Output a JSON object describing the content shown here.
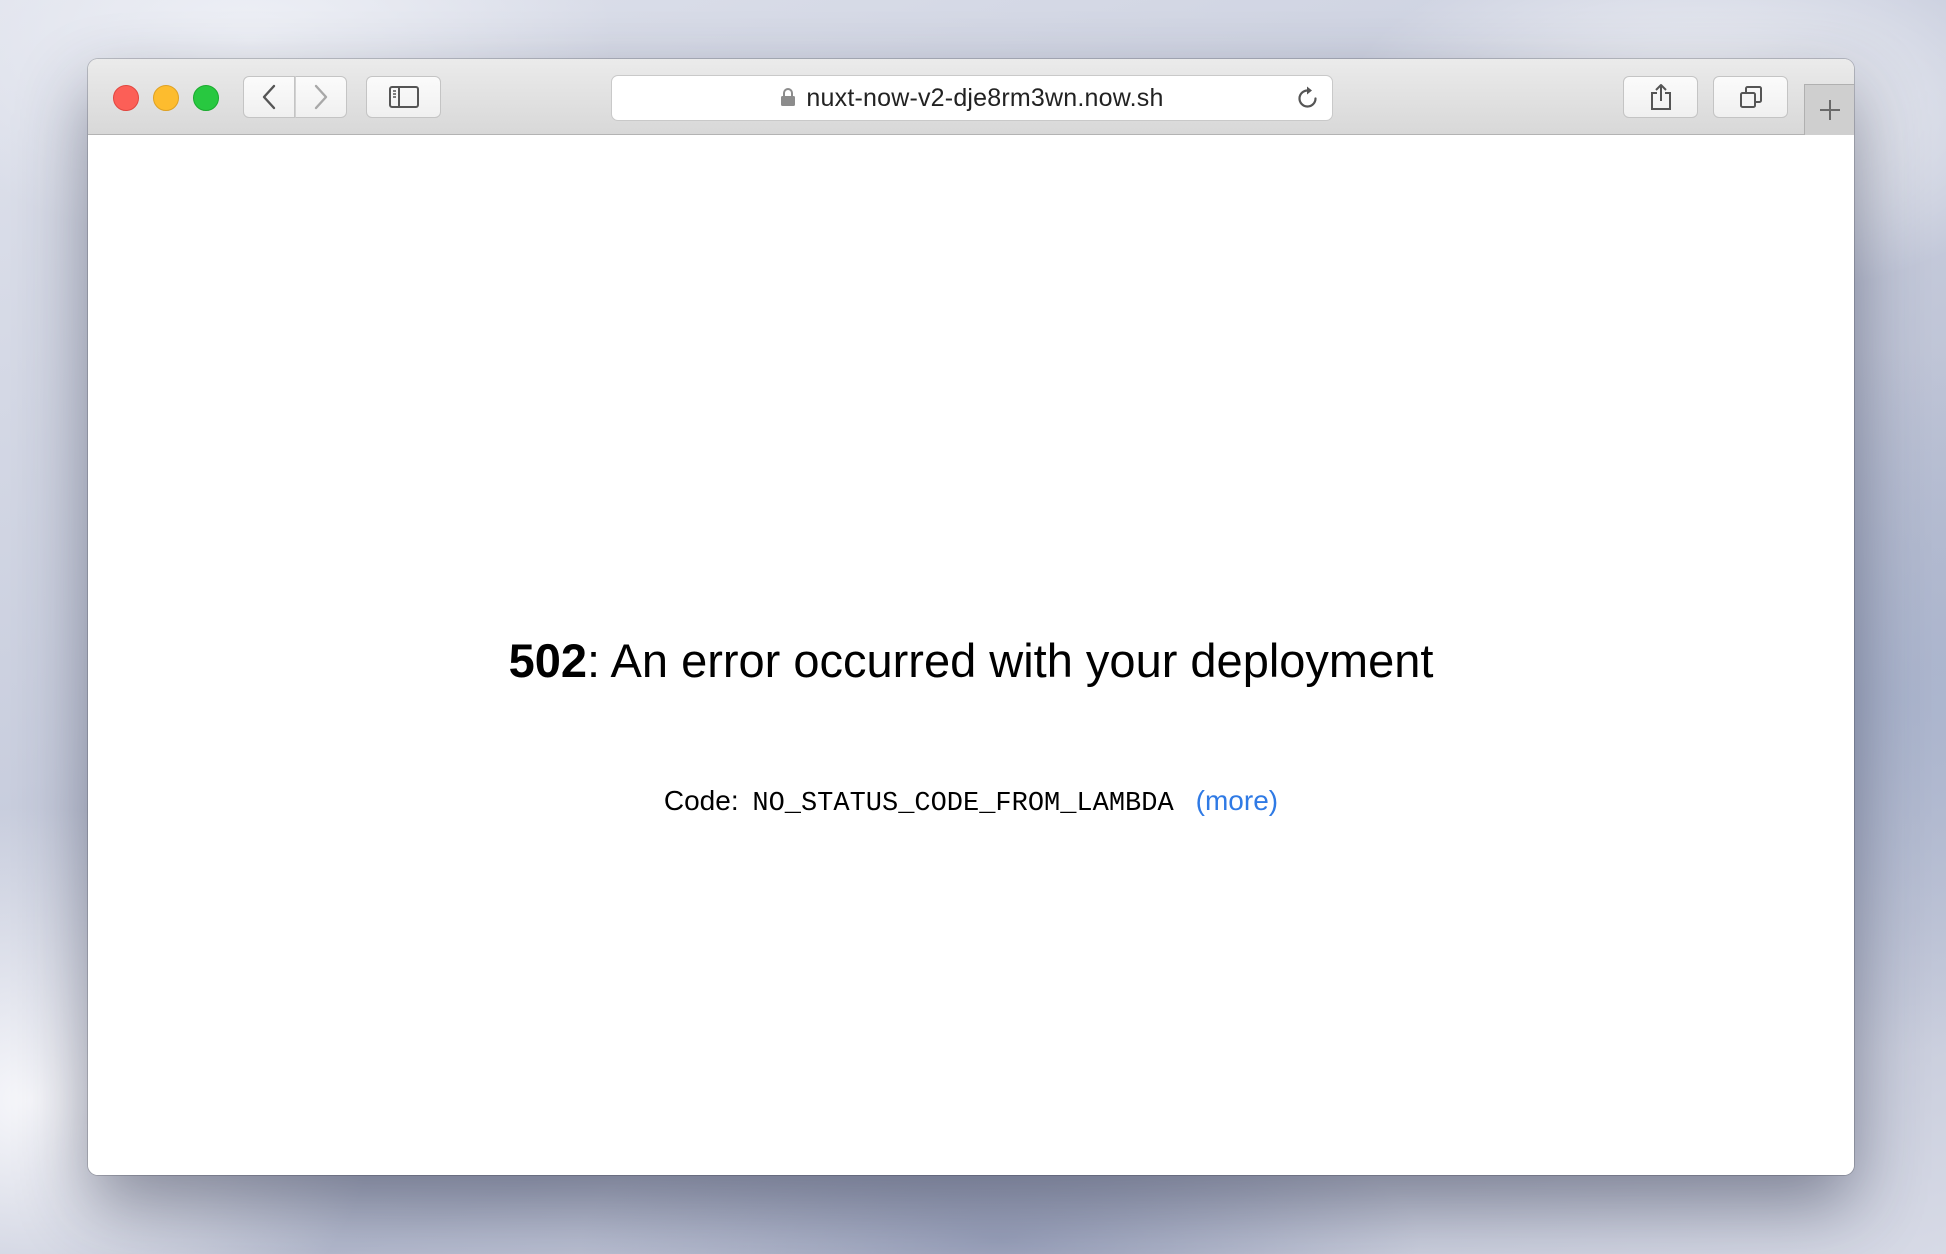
{
  "browser": {
    "address_bar": {
      "url": "nuxt-now-v2-dje8rm3wn.now.sh",
      "secure_icon": "lock-icon",
      "reload_icon": "reload-icon"
    },
    "toolbar_icons": {
      "back": "chevron-left-icon",
      "forward": "chevron-right-icon",
      "sidebar": "sidebar-icon",
      "share": "share-icon",
      "tabs": "tabs-overview-icon",
      "new_tab": "plus-icon"
    },
    "traffic_light_colors": {
      "close": "#fc5f57",
      "minimize": "#fdbc2e",
      "maximize": "#28c840"
    }
  },
  "page": {
    "status_code": "502",
    "message": ": An error occurred with your deployment",
    "code_label": "Code:",
    "code_value": "NO_STATUS_CODE_FROM_LAMBDA",
    "more_link": "(more)",
    "link_color": "#2f7ae5"
  }
}
